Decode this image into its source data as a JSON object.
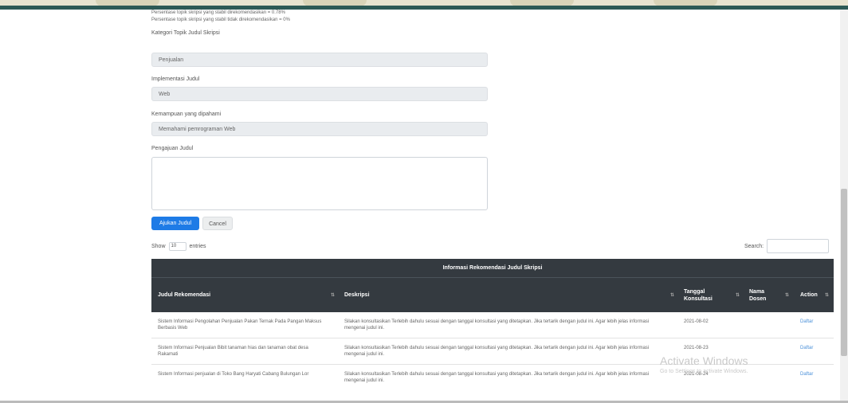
{
  "notes": [
    "Persentase topik skripsi yang stabil direkomendasikan = 0.78%",
    "Persentase topik skripsi yang stabil tidak direkomendasikan = 0%"
  ],
  "form": {
    "kategori_label": "Kategori Topik Judul Skripsi",
    "kategori_value": "Penjualan",
    "implementasi_label": "Implementasi Judul",
    "implementasi_value": "Web",
    "kemampuan_label": "Kemampuan yang dipahami",
    "kemampuan_value": "Memahami pemrograman Web",
    "pengajuan_label": "Pengajuan Judul",
    "pengajuan_value": "",
    "submit_label": "Ajukan Judul",
    "cancel_label": "Cancel"
  },
  "table_controls": {
    "show_label": "Show",
    "show_value": "10",
    "entries_label": "entries",
    "search_label": "Search:"
  },
  "table": {
    "title": "Informasi Rekomendasi Judul Skripsi",
    "columns": [
      "Judul Rekomendasi",
      "Deskripsi",
      "Tanggal Konsultasi",
      "Nama Dosen",
      "Action"
    ],
    "rows": [
      {
        "judul": "Sistem Informasi Pengolahan Penjualan Pakan Ternak Pada Pangan Maksus Berbasis Web",
        "deskripsi": "Silakan konsultasikan Terlebih dahulu sesuai dengan tanggal konsultasi yang ditetapkan. Jika tertarik dengan judul ini. Agar lebih jelas informasi mengenai judul ini.",
        "tanggal": "2021-08-02",
        "dosen": "",
        "action": "Daftar"
      },
      {
        "judul": "Sistem Informasi Penjualan Bibit tanaman hias dan tanaman obat desa Rakamati",
        "deskripsi": "Silakan konsultasikan Terlebih dahulu sesuai dengan tanggal konsultasi yang ditetapkan. Jika tertarik dengan judul ini. Agar lebih jelas informasi mengenai judul ini.",
        "tanggal": "2021-08-23",
        "dosen": "",
        "action": "Daftar"
      },
      {
        "judul": "Sistem Informasi penjualan di Toko Bang Haryati Cabang Bulungan Lor",
        "deskripsi": "Silakan konsultasikan Terlebih dahulu sesuai dengan tanggal konsultasi yang ditetapkan. Jika tertarik dengan judul ini. Agar lebih jelas informasi mengenai judul ini.",
        "tanggal": "2021-08-24",
        "dosen": "",
        "action": "Daftar"
      }
    ]
  },
  "windows_overlay": {
    "title": "Activate Windows",
    "subtitle": "Go to Settings to activate Windows."
  },
  "colors": {
    "header_band": "#2d5a56",
    "table_header": "#343a40",
    "primary_button": "#1e7be6",
    "link": "#4a90d9"
  }
}
